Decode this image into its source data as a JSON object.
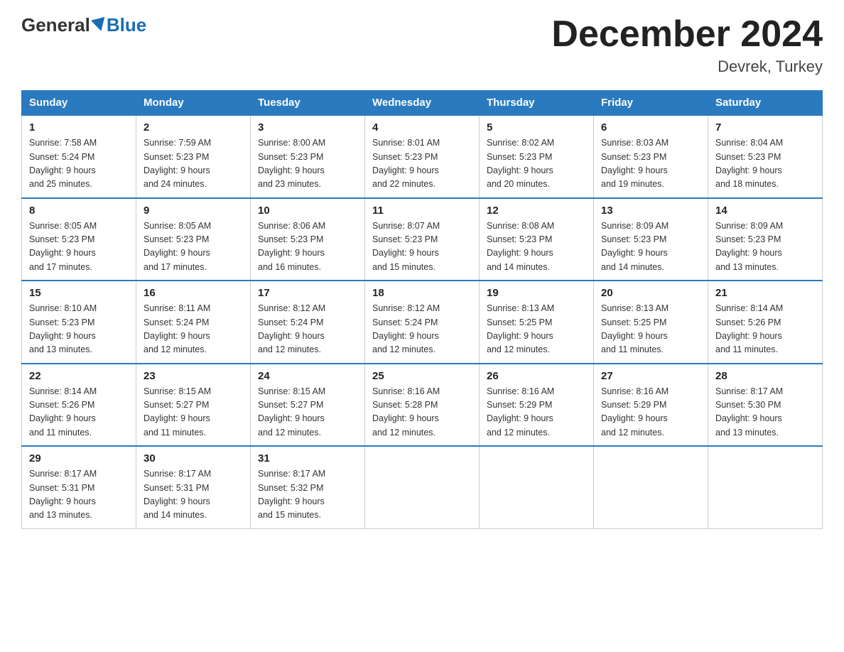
{
  "logo": {
    "general": "General",
    "blue": "Blue"
  },
  "title": "December 2024",
  "location": "Devrek, Turkey",
  "days_header": [
    "Sunday",
    "Monday",
    "Tuesday",
    "Wednesday",
    "Thursday",
    "Friday",
    "Saturday"
  ],
  "weeks": [
    [
      {
        "num": "1",
        "sunrise": "7:58 AM",
        "sunset": "5:24 PM",
        "daylight": "9 hours and 25 minutes."
      },
      {
        "num": "2",
        "sunrise": "7:59 AM",
        "sunset": "5:23 PM",
        "daylight": "9 hours and 24 minutes."
      },
      {
        "num": "3",
        "sunrise": "8:00 AM",
        "sunset": "5:23 PM",
        "daylight": "9 hours and 23 minutes."
      },
      {
        "num": "4",
        "sunrise": "8:01 AM",
        "sunset": "5:23 PM",
        "daylight": "9 hours and 22 minutes."
      },
      {
        "num": "5",
        "sunrise": "8:02 AM",
        "sunset": "5:23 PM",
        "daylight": "9 hours and 20 minutes."
      },
      {
        "num": "6",
        "sunrise": "8:03 AM",
        "sunset": "5:23 PM",
        "daylight": "9 hours and 19 minutes."
      },
      {
        "num": "7",
        "sunrise": "8:04 AM",
        "sunset": "5:23 PM",
        "daylight": "9 hours and 18 minutes."
      }
    ],
    [
      {
        "num": "8",
        "sunrise": "8:05 AM",
        "sunset": "5:23 PM",
        "daylight": "9 hours and 17 minutes."
      },
      {
        "num": "9",
        "sunrise": "8:05 AM",
        "sunset": "5:23 PM",
        "daylight": "9 hours and 17 minutes."
      },
      {
        "num": "10",
        "sunrise": "8:06 AM",
        "sunset": "5:23 PM",
        "daylight": "9 hours and 16 minutes."
      },
      {
        "num": "11",
        "sunrise": "8:07 AM",
        "sunset": "5:23 PM",
        "daylight": "9 hours and 15 minutes."
      },
      {
        "num": "12",
        "sunrise": "8:08 AM",
        "sunset": "5:23 PM",
        "daylight": "9 hours and 14 minutes."
      },
      {
        "num": "13",
        "sunrise": "8:09 AM",
        "sunset": "5:23 PM",
        "daylight": "9 hours and 14 minutes."
      },
      {
        "num": "14",
        "sunrise": "8:09 AM",
        "sunset": "5:23 PM",
        "daylight": "9 hours and 13 minutes."
      }
    ],
    [
      {
        "num": "15",
        "sunrise": "8:10 AM",
        "sunset": "5:23 PM",
        "daylight": "9 hours and 13 minutes."
      },
      {
        "num": "16",
        "sunrise": "8:11 AM",
        "sunset": "5:24 PM",
        "daylight": "9 hours and 12 minutes."
      },
      {
        "num": "17",
        "sunrise": "8:12 AM",
        "sunset": "5:24 PM",
        "daylight": "9 hours and 12 minutes."
      },
      {
        "num": "18",
        "sunrise": "8:12 AM",
        "sunset": "5:24 PM",
        "daylight": "9 hours and 12 minutes."
      },
      {
        "num": "19",
        "sunrise": "8:13 AM",
        "sunset": "5:25 PM",
        "daylight": "9 hours and 12 minutes."
      },
      {
        "num": "20",
        "sunrise": "8:13 AM",
        "sunset": "5:25 PM",
        "daylight": "9 hours and 11 minutes."
      },
      {
        "num": "21",
        "sunrise": "8:14 AM",
        "sunset": "5:26 PM",
        "daylight": "9 hours and 11 minutes."
      }
    ],
    [
      {
        "num": "22",
        "sunrise": "8:14 AM",
        "sunset": "5:26 PM",
        "daylight": "9 hours and 11 minutes."
      },
      {
        "num": "23",
        "sunrise": "8:15 AM",
        "sunset": "5:27 PM",
        "daylight": "9 hours and 11 minutes."
      },
      {
        "num": "24",
        "sunrise": "8:15 AM",
        "sunset": "5:27 PM",
        "daylight": "9 hours and 12 minutes."
      },
      {
        "num": "25",
        "sunrise": "8:16 AM",
        "sunset": "5:28 PM",
        "daylight": "9 hours and 12 minutes."
      },
      {
        "num": "26",
        "sunrise": "8:16 AM",
        "sunset": "5:29 PM",
        "daylight": "9 hours and 12 minutes."
      },
      {
        "num": "27",
        "sunrise": "8:16 AM",
        "sunset": "5:29 PM",
        "daylight": "9 hours and 12 minutes."
      },
      {
        "num": "28",
        "sunrise": "8:17 AM",
        "sunset": "5:30 PM",
        "daylight": "9 hours and 13 minutes."
      }
    ],
    [
      {
        "num": "29",
        "sunrise": "8:17 AM",
        "sunset": "5:31 PM",
        "daylight": "9 hours and 13 minutes."
      },
      {
        "num": "30",
        "sunrise": "8:17 AM",
        "sunset": "5:31 PM",
        "daylight": "9 hours and 14 minutes."
      },
      {
        "num": "31",
        "sunrise": "8:17 AM",
        "sunset": "5:32 PM",
        "daylight": "9 hours and 15 minutes."
      },
      null,
      null,
      null,
      null
    ]
  ],
  "labels": {
    "sunrise": "Sunrise: ",
    "sunset": "Sunset: ",
    "daylight": "Daylight: "
  }
}
